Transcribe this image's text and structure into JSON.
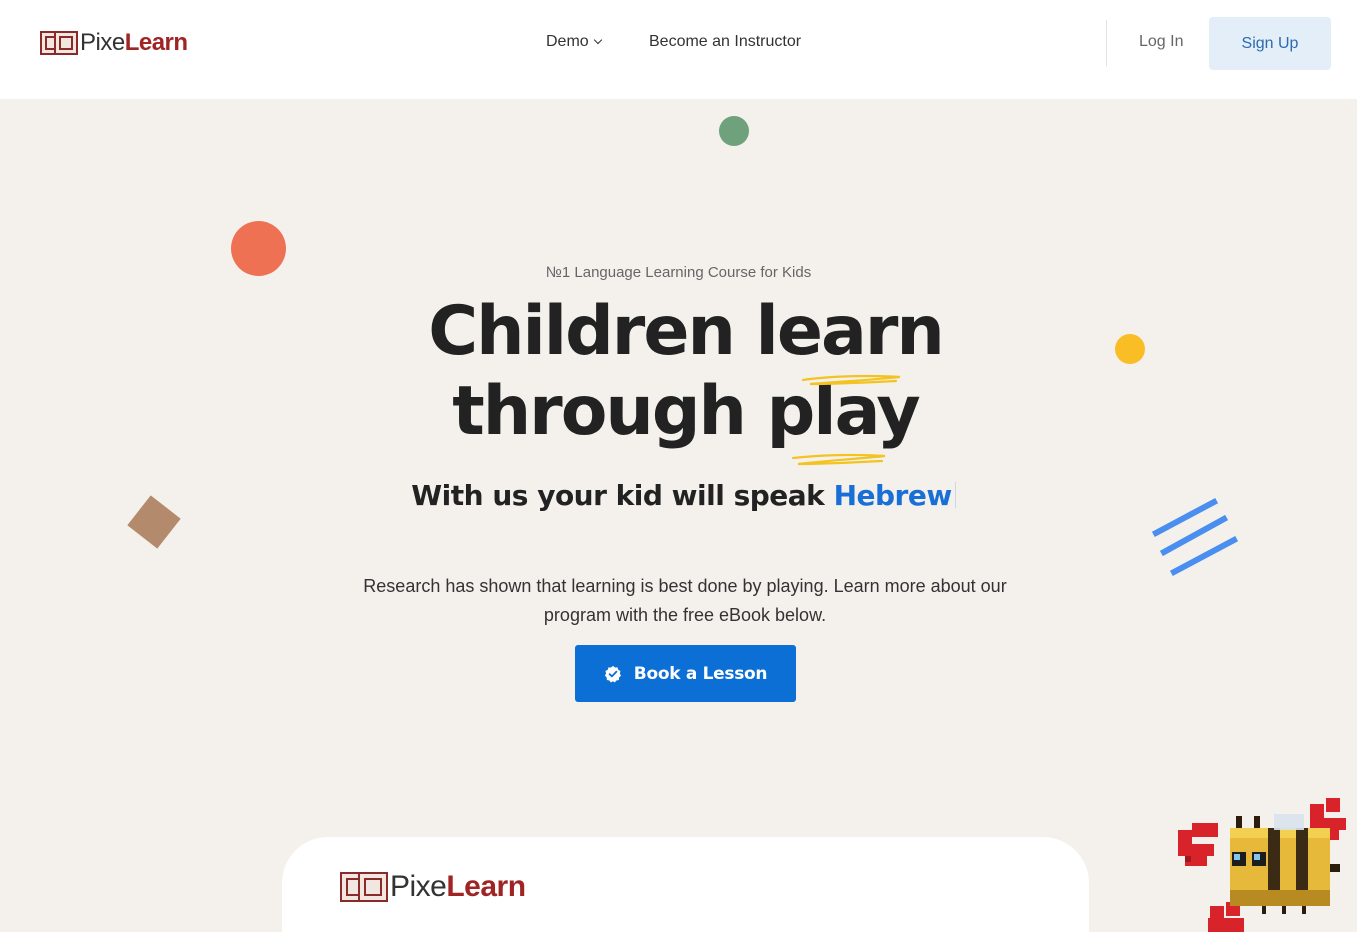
{
  "header": {
    "logo": {
      "part1": "Pixe",
      "part2": "Learn"
    },
    "nav": {
      "demo_label": "Demo",
      "instructor_label": "Become an Instructor"
    },
    "login_label": "Log In",
    "signup_label": "Sign Up"
  },
  "hero": {
    "eyebrow": "№1 Language Learning Course for Kids",
    "headline_line1": "Children learn",
    "headline_line2_a": "through ",
    "headline_line2_b": "play",
    "subhead_prefix": "With us your kid will speak ",
    "subhead_highlight": "Hebrew",
    "body": "Research has shown that learning is best done by playing. Learn more about our program with the free eBook below.",
    "cta_label": "Book a Lesson"
  },
  "card": {
    "logo": {
      "part1": "Pixe",
      "part2": "Learn"
    }
  },
  "colors": {
    "accent_blue": "#0b6fd6",
    "highlight_blue": "#1a6fd6",
    "logo_red": "#a02424",
    "background": "#f4f1ed",
    "deco_green": "#6fa27c",
    "deco_orange": "#ef7154",
    "deco_yellow": "#f9be26",
    "deco_brown": "#b48a6c",
    "deco_stripes": "#4a8ef0"
  },
  "icons": {
    "cta_icon": "verified-check-icon",
    "nav_demo_icon": "chevron-down-icon",
    "logo_icon": "pixelearn-logo-icon",
    "mascot": "pixel-bee-icon"
  }
}
